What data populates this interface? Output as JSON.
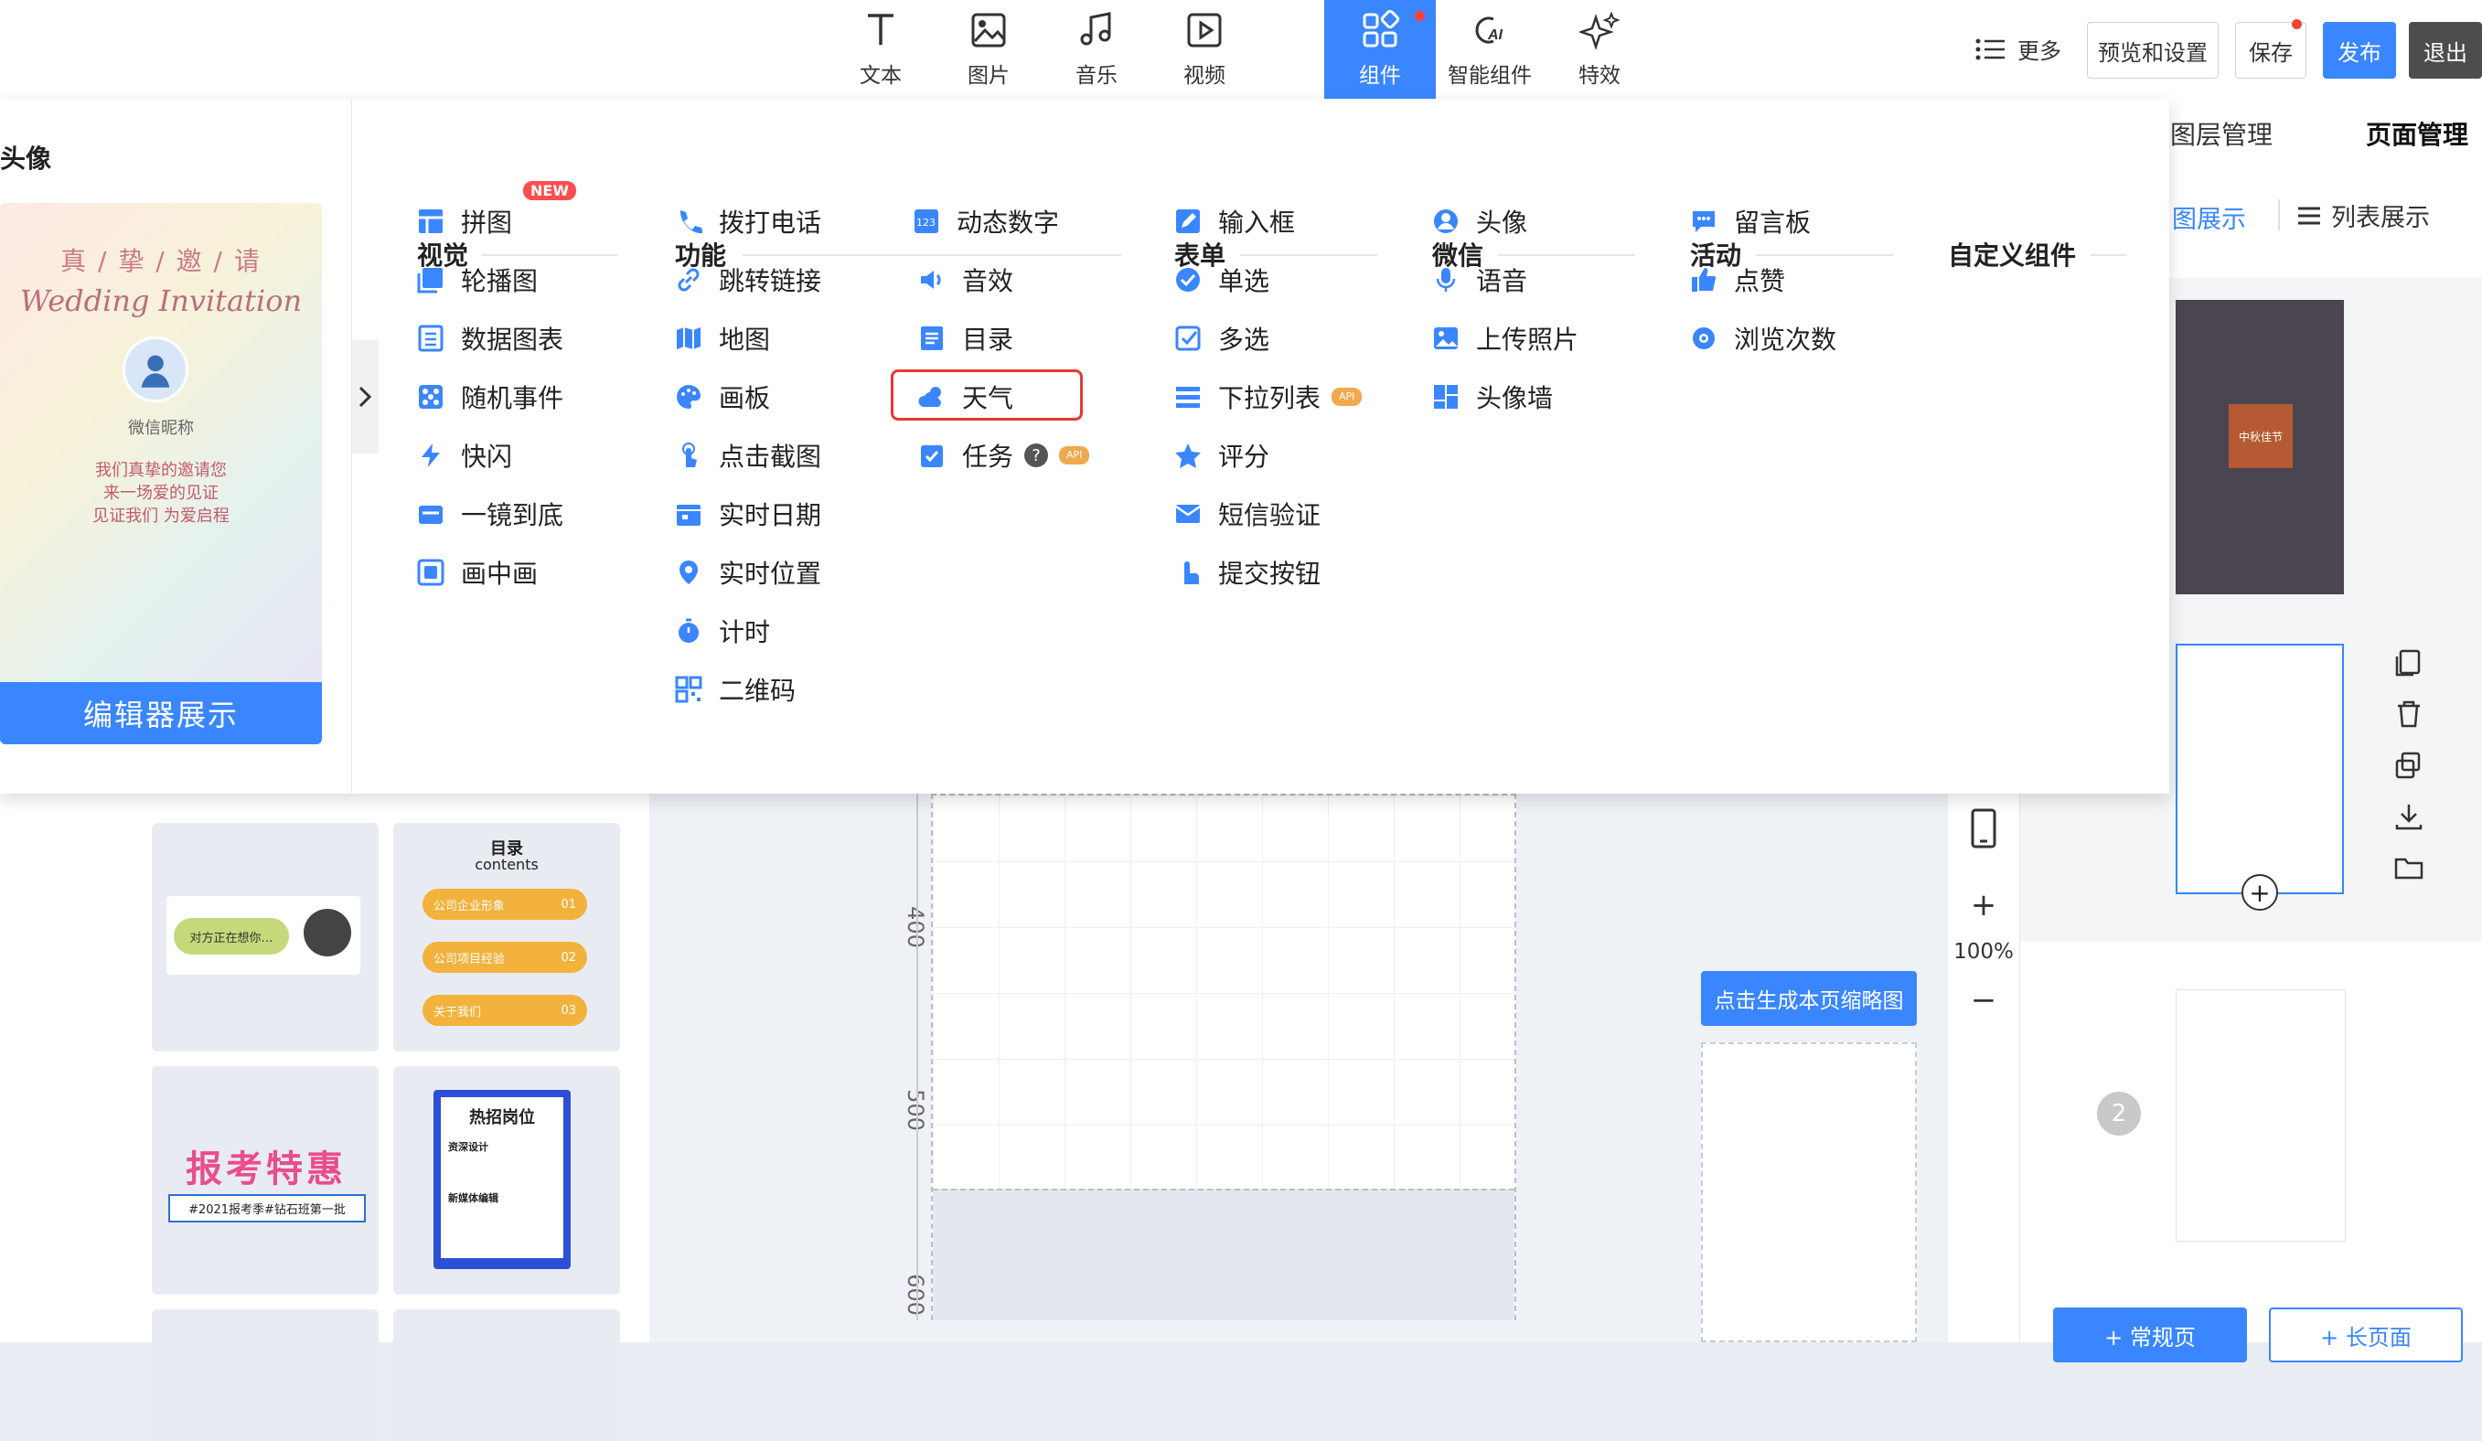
{
  "toolbar": {
    "tools": [
      {
        "label": "文本",
        "icon": "text-icon"
      },
      {
        "label": "图片",
        "icon": "image-icon"
      },
      {
        "label": "音乐",
        "icon": "music-icon"
      },
      {
        "label": "视频",
        "icon": "video-icon"
      },
      {
        "label": "组件",
        "icon": "component-icon",
        "active": true
      },
      {
        "label": "智能组件",
        "icon": "ai-icon"
      },
      {
        "label": "特效",
        "icon": "sparkle-icon"
      }
    ],
    "more": "更多",
    "preview": "预览和设置",
    "save": "保存",
    "publish": "发布",
    "exit": "退出"
  },
  "preview_card": {
    "heading": "头像",
    "invite_title": "真 / 挚 / 邀 / 请",
    "invite_script": "Wedding Invitation",
    "nickname": "微信昵称",
    "lines": [
      "我们真挚的邀请您",
      "来一场爱的见证",
      "见证我们 为爱启程"
    ],
    "footer": "编辑器展示"
  },
  "sections": {
    "visual": "视觉",
    "function": "功能",
    "form": "表单",
    "wechat": "微信",
    "activity": "活动",
    "custom": "自定义组件"
  },
  "visual_items": [
    "拼图",
    "轮播图",
    "数据图表",
    "随机事件",
    "快闪",
    "一镜到底",
    "画中画"
  ],
  "new_badge": "NEW",
  "function_items_a": [
    "拨打电话",
    "跳转链接",
    "地图",
    "画板",
    "点击截图",
    "实时日期",
    "实时位置",
    "计时",
    "二维码"
  ],
  "function_items_b": [
    "动态数字",
    "音效",
    "目录",
    "天气",
    "任务"
  ],
  "form_items": [
    "输入框",
    "单选",
    "多选",
    "下拉列表",
    "评分",
    "短信验证",
    "提交按钮"
  ],
  "wechat_items": [
    "头像",
    "语音",
    "上传照片",
    "头像墙"
  ],
  "activity_items": [
    "留言板",
    "点赞",
    "浏览次数"
  ],
  "api_badge": "API",
  "help_mark": "?",
  "right_panel": {
    "tab_layers": "图层管理",
    "tab_pages": "页面管理",
    "view_grid": "图展示",
    "view_list": "列表展示",
    "thumb_text": "中秋佳节",
    "page_number": "2",
    "btn_normal": "+ 常规页",
    "btn_long": "+ 长页面"
  },
  "canvas": {
    "ruler_labels": [
      "400",
      "500",
      "600"
    ],
    "zoom": "100%",
    "plus": "+",
    "minus": "−",
    "thumb_button": "点击生成本页缩略图"
  },
  "library": {
    "chat_text": "对方正在想你…",
    "catalog_title": "目录",
    "catalog_sub": "contents",
    "catalog_items": [
      "公司企业形象",
      "公司项目经验",
      "关于我们"
    ],
    "catalog_nums": [
      "01",
      "02",
      "03"
    ],
    "promo_big": "报考特惠",
    "promo_tag": "#2021报考季#钻石班第一批",
    "job_title": "热招岗位",
    "job_sub1": "资深设计",
    "job_sub2": "新媒体编辑"
  },
  "colors": {
    "accent": "#3a86ff",
    "highlight": "#e53935",
    "api": "#f0a94d",
    "new": "#ff4d4f"
  }
}
